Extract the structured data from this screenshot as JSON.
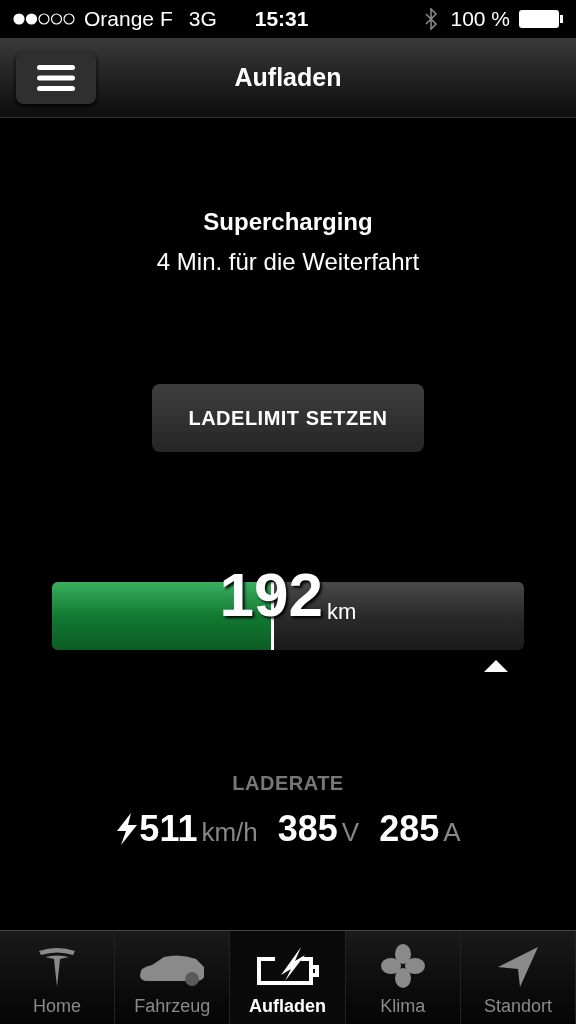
{
  "status_bar": {
    "carrier": "Orange F",
    "network": "3G",
    "time": "15:31",
    "battery": "100 %"
  },
  "header": {
    "title": "Aufladen"
  },
  "charging": {
    "status": "Supercharging",
    "remaining": "4 Min. für die Weiterfahrt"
  },
  "limit_button": {
    "label": "LADELIMIT SETZEN"
  },
  "battery_bar": {
    "level": 0.47,
    "range": "192",
    "unit": "km"
  },
  "charge_rate": {
    "label": "LADERATE",
    "stats": [
      {
        "value": "511",
        "unit": "km/h"
      },
      {
        "value": "385",
        "unit": "V"
      },
      {
        "value": "285",
        "unit": "A"
      }
    ]
  },
  "tabs": [
    {
      "kind": "home",
      "label": "Home",
      "selected": false
    },
    {
      "kind": "car",
      "label": "Fahrzeug",
      "selected": false
    },
    {
      "kind": "charge",
      "label": "Aufladen",
      "selected": true
    },
    {
      "kind": "climate",
      "label": "Klima",
      "selected": false
    },
    {
      "kind": "location",
      "label": "Standort",
      "selected": false
    }
  ]
}
